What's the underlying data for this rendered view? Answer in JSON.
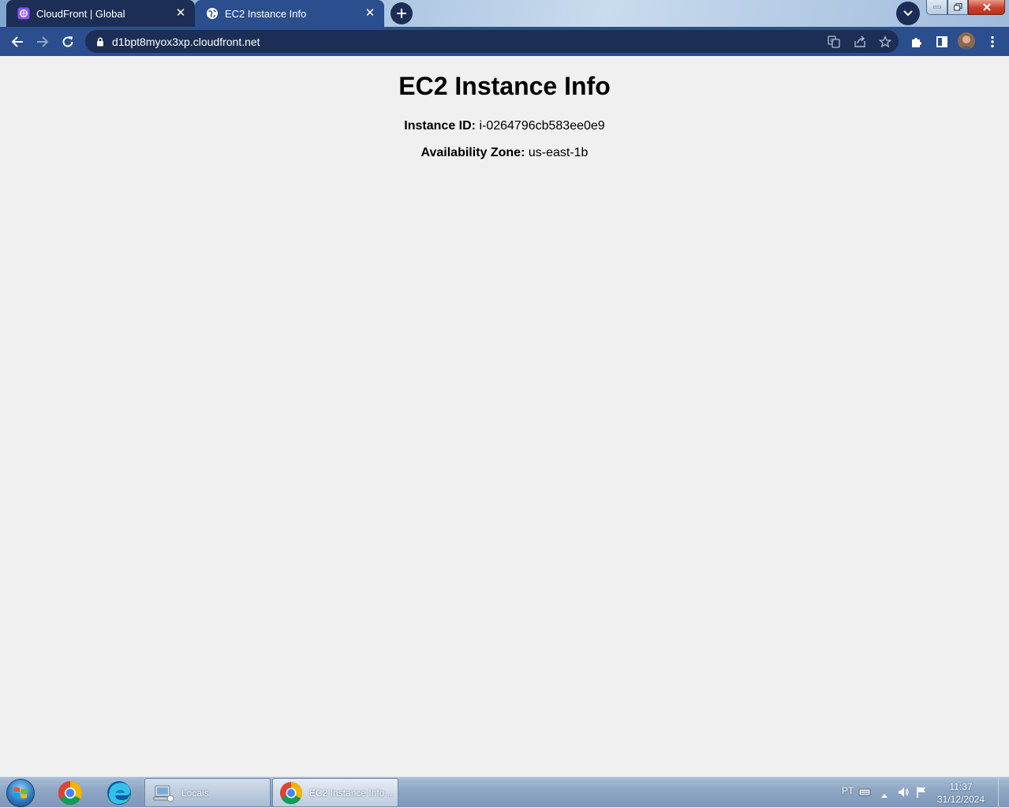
{
  "browser": {
    "tabs": [
      {
        "title": "CloudFront | Global",
        "favicon": "cloudfront-icon"
      },
      {
        "title": "EC2 Instance Info",
        "favicon": "globe-icon"
      }
    ],
    "url": "d1bpt8myox3xp.cloudfront.net"
  },
  "page": {
    "heading": "EC2 Instance Info",
    "instance_id_label": "Instance ID:",
    "instance_id_value": "i-0264796cb583ee0e9",
    "az_label": "Availability Zone:",
    "az_value": "us-east-1b"
  },
  "taskbar": {
    "tasks": [
      {
        "label": "Locais"
      },
      {
        "label": "EC2 Instance Info ..."
      }
    ],
    "language": "PT",
    "time": "11:37",
    "date": "31/12/2024"
  },
  "colors": {
    "tab_active": "#2b4e8e",
    "tab_inactive": "#1c2e55",
    "page_background": "#f0f0f0"
  }
}
